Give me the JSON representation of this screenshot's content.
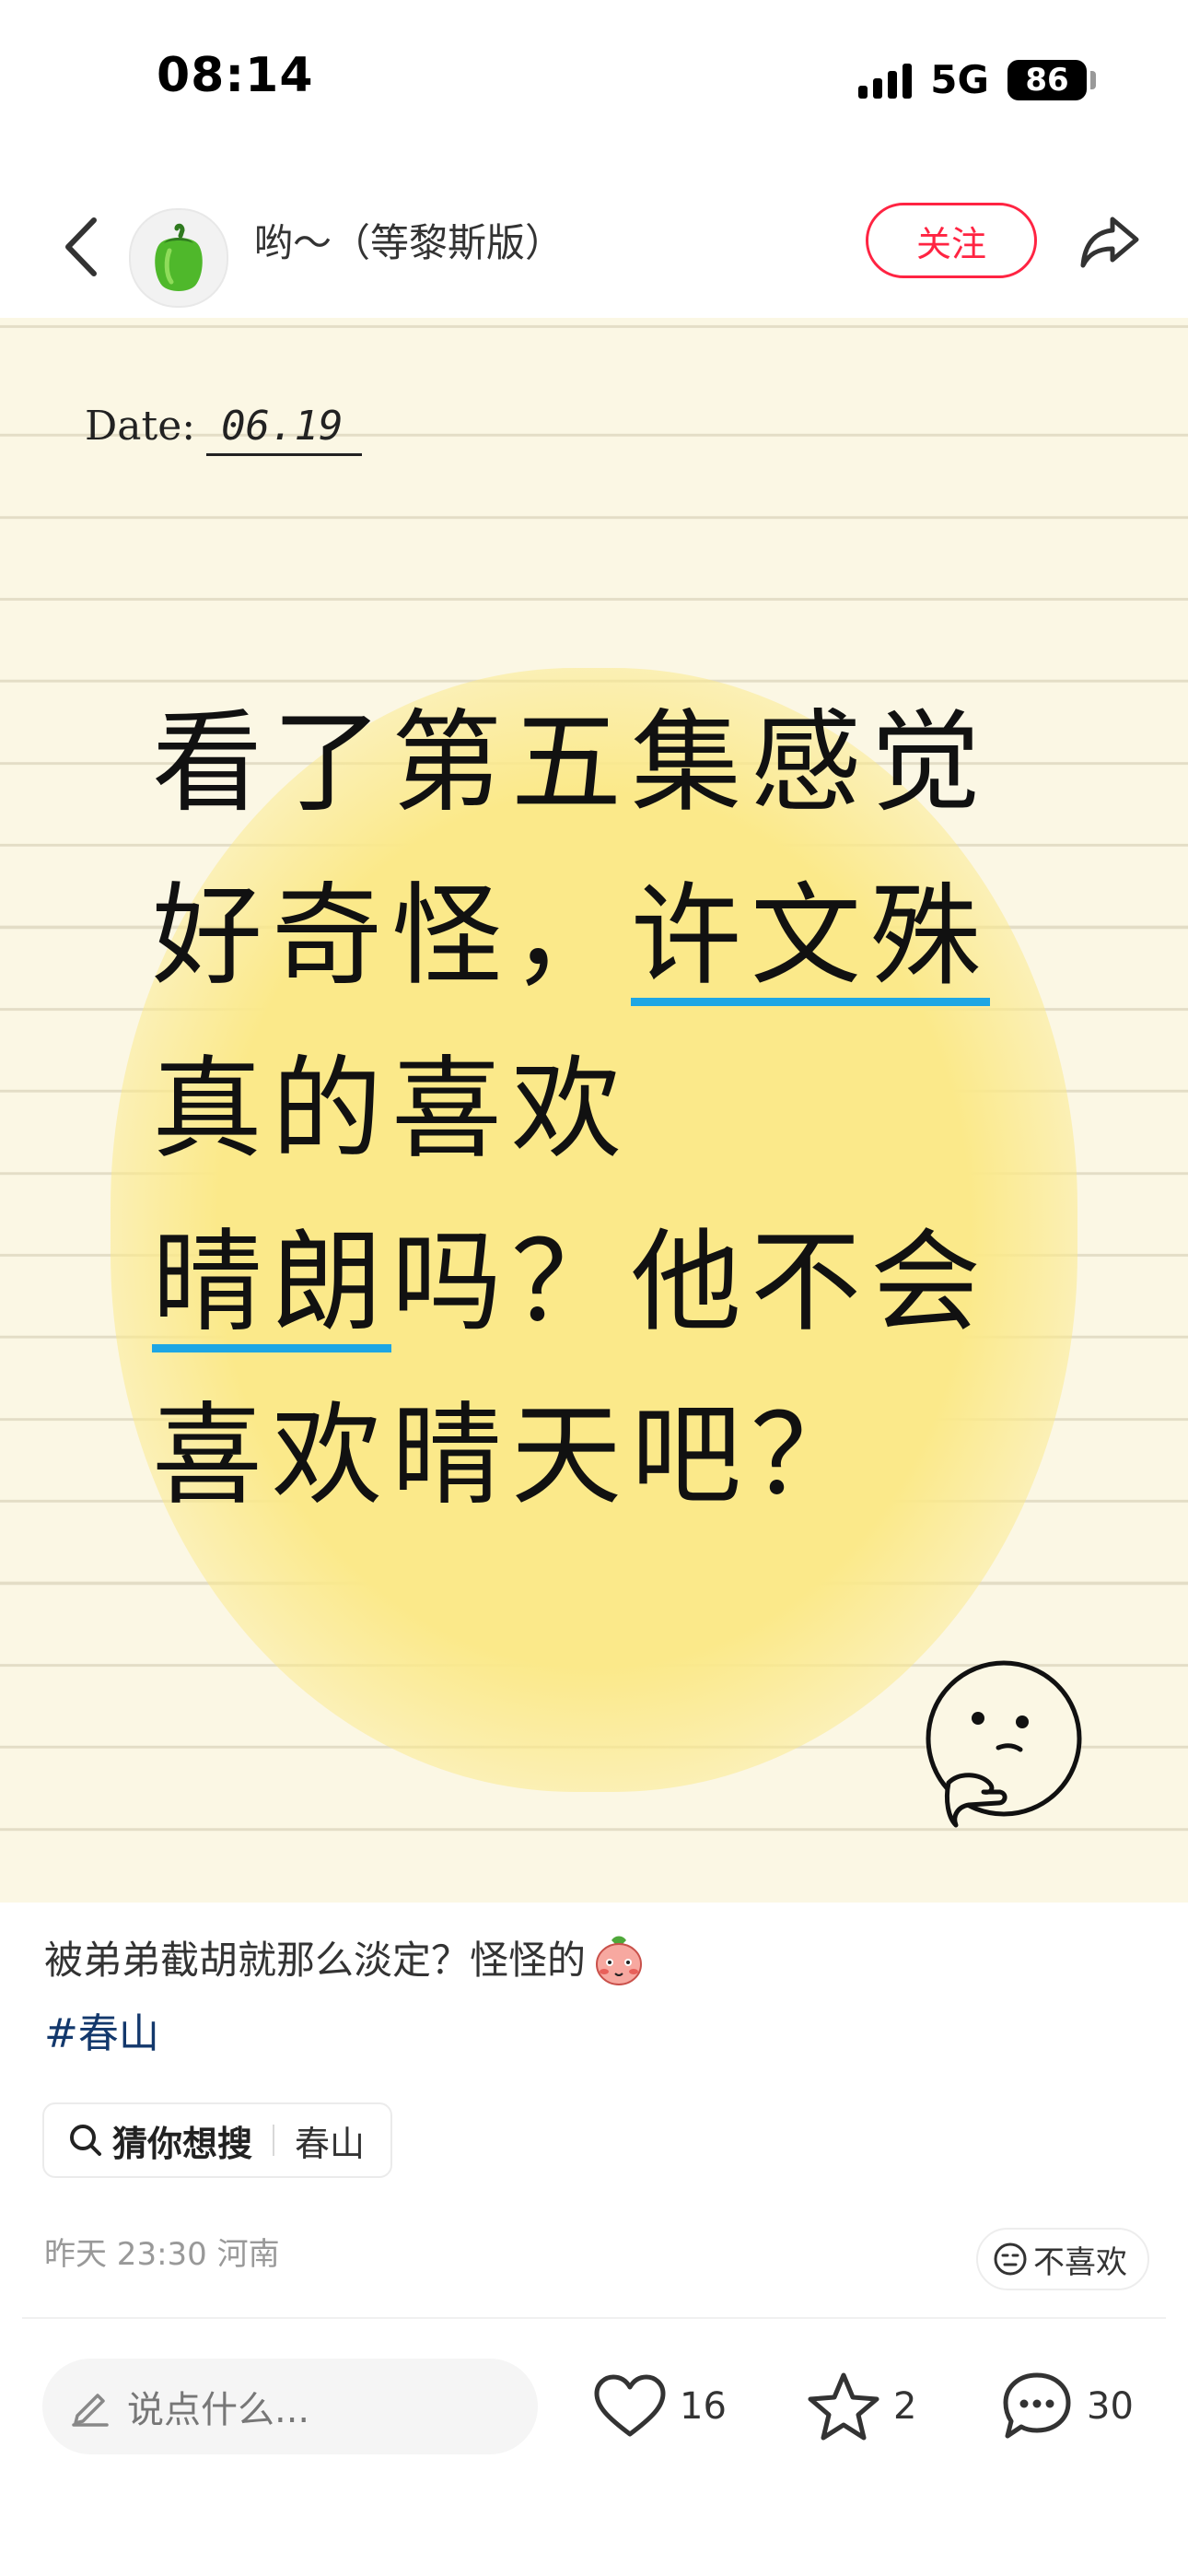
{
  "status_bar": {
    "time": "08:14",
    "network": "5G",
    "battery": "86"
  },
  "header": {
    "author_name": "哟～（等黎斯版）",
    "follow_label": "关注"
  },
  "note_image": {
    "date_label": "Date:",
    "date_value": "06.19",
    "lines": [
      {
        "text": "看了第五集感觉"
      },
      {
        "prefix": "好奇怪，",
        "underlined": "许文殊"
      },
      {
        "text": "真的喜欢"
      },
      {
        "underlined": "晴朗",
        "suffix": "吗？他不会"
      },
      {
        "text": "喜欢晴天吧？"
      }
    ],
    "underline_color": "#1ea6e4",
    "highlight_color": "#fbe98a"
  },
  "caption": {
    "text": "被弟弟截胡就那么淡定？怪怪的",
    "emoji": "blushing-face-icon"
  },
  "hashtag": "#春山",
  "search_suggestion": {
    "prefix": "猜你想搜",
    "term": "春山"
  },
  "meta": {
    "timestamp": "昨天 23:30",
    "location": "河南"
  },
  "dislike_label": "不喜欢",
  "bottom_bar": {
    "comment_placeholder": "说点什么...",
    "likes": "16",
    "collects": "2",
    "comments": "30"
  },
  "colors": {
    "brand_red": "#ff2442",
    "hashtag_blue": "#13386c",
    "paper": "#fbf7e4"
  }
}
